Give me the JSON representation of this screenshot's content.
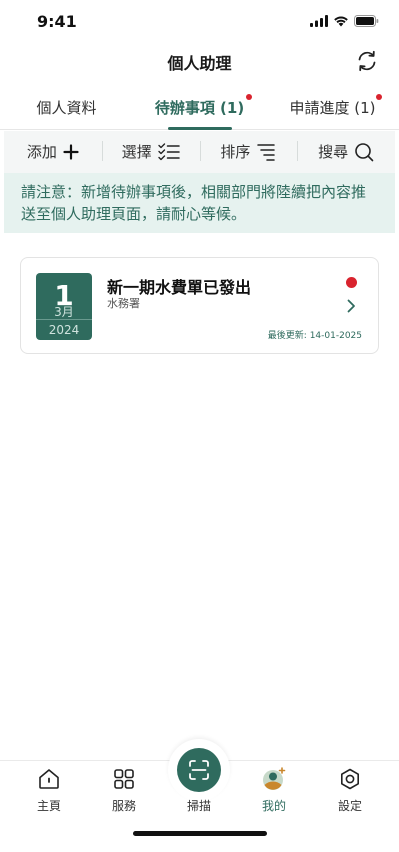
{
  "status": {
    "time": "9:41"
  },
  "header": {
    "title": "個人助理"
  },
  "tabs": [
    {
      "label": "個人資料",
      "has_dot": false
    },
    {
      "label": "待辦事項 (1)",
      "has_dot": true,
      "active": true
    },
    {
      "label": "申請進度 (1)",
      "has_dot": true
    }
  ],
  "toolbar": {
    "add": "添加",
    "select": "選擇",
    "sort": "排序",
    "search": "搜尋"
  },
  "notice": "請注意：新增待辦事項後，相關部門將陸續把內容推送至個人助理頁面，請耐心等候。",
  "todo": {
    "day": "1",
    "month": "3月",
    "year": "2024",
    "title": "新一期水費單已發出",
    "department": "水務署",
    "updated": "最後更新: 14-01-2025"
  },
  "nav": {
    "home": "主頁",
    "services": "服務",
    "scan": "掃描",
    "mine": "我的",
    "settings": "設定"
  },
  "colors": {
    "accent": "#2f6b5e",
    "alert": "#d9232e",
    "notice_bg": "#e6f2ef"
  }
}
